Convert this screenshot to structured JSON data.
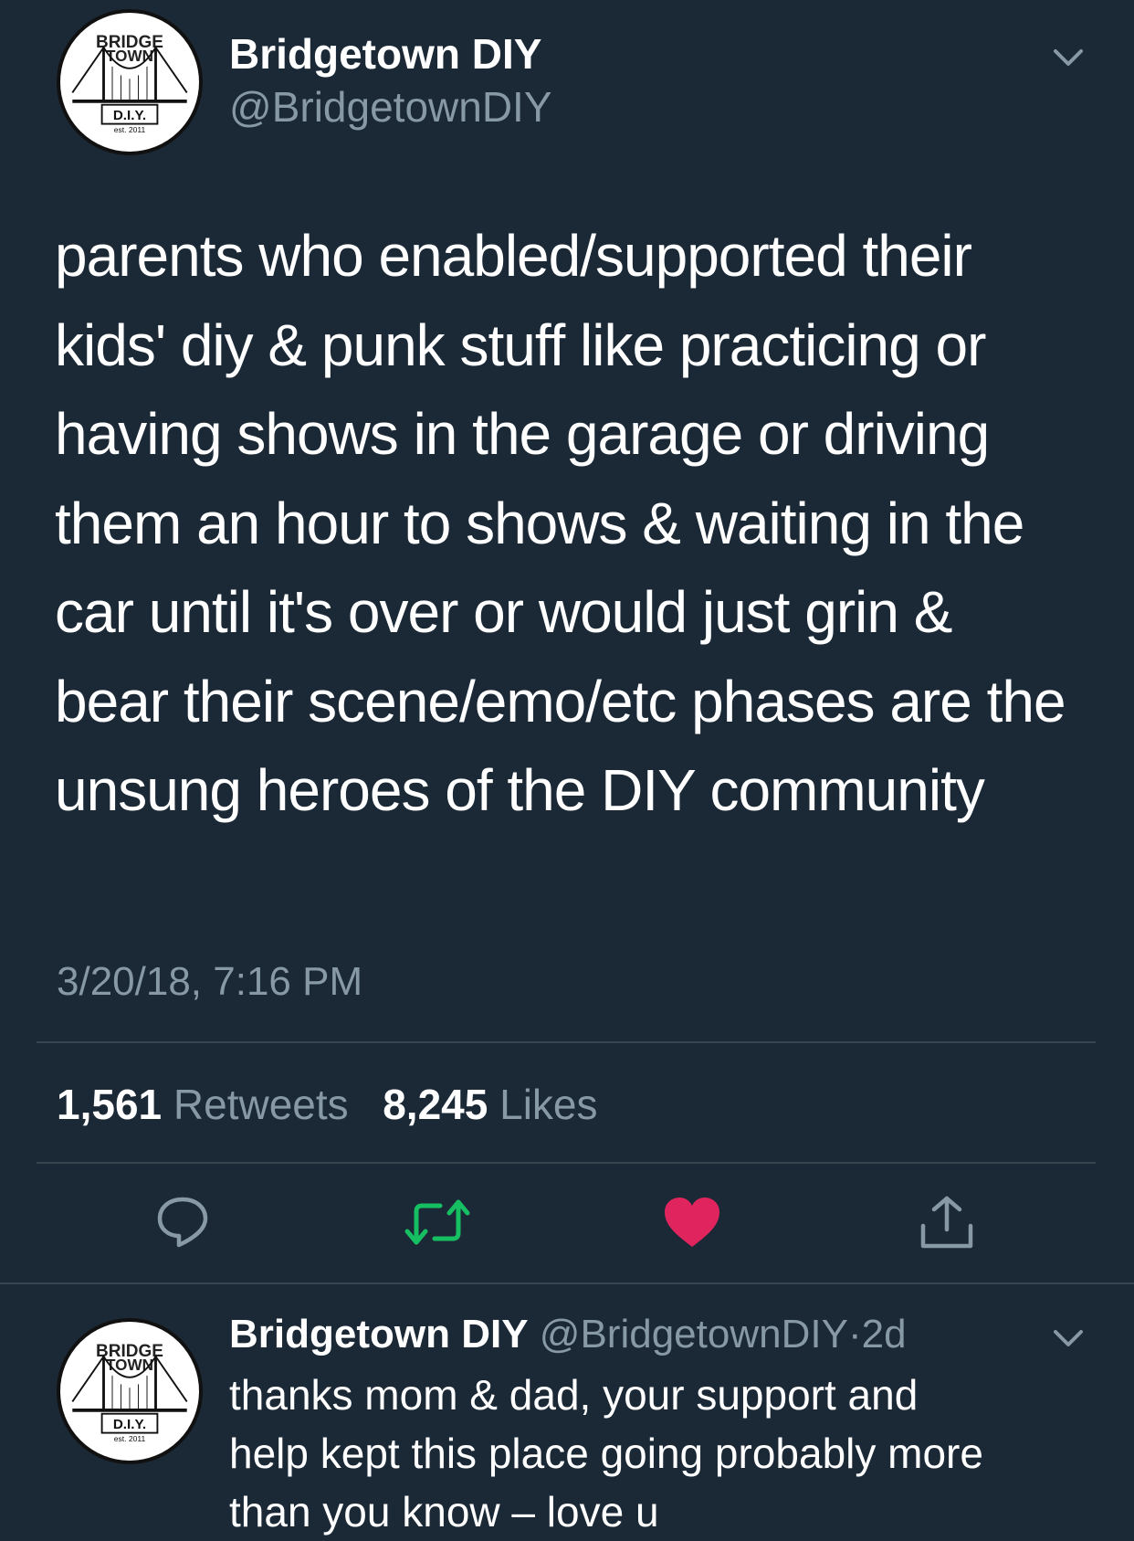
{
  "tweet": {
    "author": {
      "name": "Bridgetown DIY",
      "handle": "@BridgetownDIY"
    },
    "avatar": {
      "logo_top": "BRIDGE",
      "logo_top2": "TOWN",
      "logo_bottom": "D.I.Y.",
      "logo_est": "est. 2011"
    },
    "text": "parents who enabled/supported their kids' diy & punk stuff like practicing or having shows in the garage or driving them an hour to shows & waiting in the car until it's over or would just grin & bear their scene/emo/etc phases are the unsung heroes of the DIY community",
    "timestamp": "3/20/18, 7:16 PM",
    "retweets": {
      "count": "1,561",
      "label": "Retweets"
    },
    "likes": {
      "count": "8,245",
      "label": "Likes"
    },
    "actions": [
      {
        "name": "reply",
        "icon": "reply-icon",
        "color": "#8899a6"
      },
      {
        "name": "retweet",
        "icon": "retweet-icon",
        "color": "#17bf63"
      },
      {
        "name": "like",
        "icon": "heart-icon",
        "color": "#e0245e"
      },
      {
        "name": "share",
        "icon": "share-icon",
        "color": "#8899a6"
      }
    ]
  },
  "reply": {
    "author": {
      "name": "Bridgetown DIY",
      "handle": "@BridgetownDIY",
      "separator": "·",
      "age": "2d"
    },
    "text_lines": [
      "thanks mom & dad, your support and",
      "help kept this place going probably more",
      "than you know – love u"
    ]
  },
  "colors": {
    "background": "#1b2836",
    "secondary_text": "#8899a6",
    "divider": "#38444d"
  }
}
